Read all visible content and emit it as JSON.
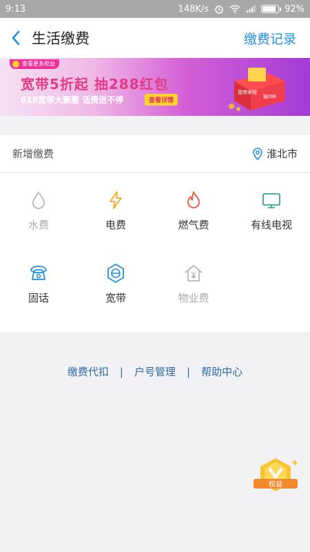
{
  "status": {
    "time": "9:13",
    "speed": "148K/s",
    "battery_pct": "92%",
    "battery_level": 0.92
  },
  "header": {
    "title": "生活缴费",
    "record": "缴费记录"
  },
  "banner": {
    "tag": "查看更多权益",
    "headline": "宽带5折起  抽288红包",
    "sub": "618宽带大聚惠  话费送不停",
    "detail": "查看详情",
    "box_text": "宽带来啦",
    "box_num": "抽288"
  },
  "section": {
    "label": "新增缴费",
    "city": "淮北市"
  },
  "services": [
    {
      "label": "水费",
      "icon": "water-drop-icon",
      "enabled": false
    },
    {
      "label": "电费",
      "icon": "lightning-icon",
      "enabled": true
    },
    {
      "label": "燃气费",
      "icon": "flame-icon",
      "enabled": true
    },
    {
      "label": "有线电视",
      "icon": "tv-icon",
      "enabled": true
    },
    {
      "label": "固话",
      "icon": "telephone-icon",
      "enabled": true
    },
    {
      "label": "宽带",
      "icon": "broadband-icon",
      "enabled": true
    },
    {
      "label": "物业费",
      "icon": "house-yuan-icon",
      "enabled": false
    }
  ],
  "links": {
    "a": "缴费代扣",
    "b": "户号管理",
    "c": "帮助中心"
  },
  "badge": {
    "label": "权益"
  }
}
